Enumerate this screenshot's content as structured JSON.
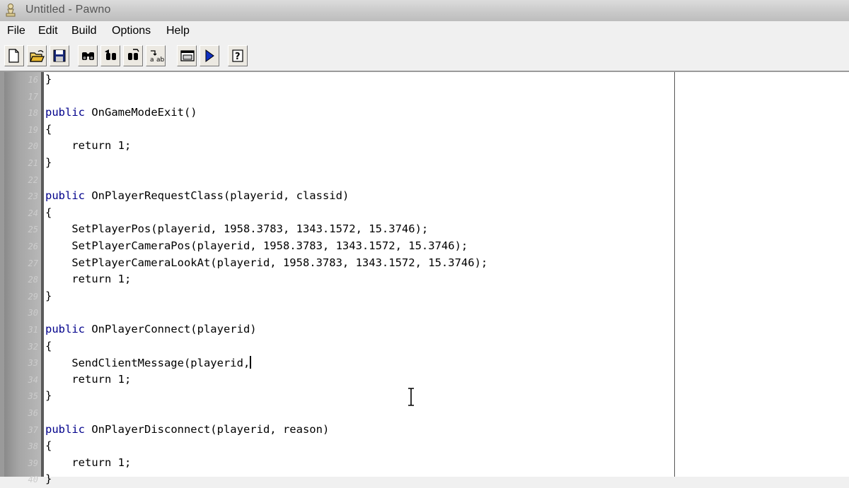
{
  "window": {
    "title": "Untitled - Pawno"
  },
  "menu": [
    "File",
    "Edit",
    "Build",
    "Options",
    "Help"
  ],
  "toolbar": {
    "buttons": [
      "new-file-icon",
      "open-folder-icon",
      "save-icon",
      "find-icon",
      "find-next-icon",
      "find-replace-icon",
      "replace-icon",
      "function-list-icon",
      "compile-run-icon",
      "help-icon"
    ]
  },
  "editor": {
    "lines": [
      {
        "num": "16",
        "keyword": "",
        "text": "}"
      },
      {
        "num": "17",
        "keyword": "",
        "text": ""
      },
      {
        "num": "18",
        "keyword": "public",
        "text": " OnGameModeExit()"
      },
      {
        "num": "19",
        "keyword": "",
        "text": "{"
      },
      {
        "num": "20",
        "keyword": "",
        "text": "    return 1;"
      },
      {
        "num": "21",
        "keyword": "",
        "text": "}"
      },
      {
        "num": "22",
        "keyword": "",
        "text": ""
      },
      {
        "num": "23",
        "keyword": "public",
        "text": " OnPlayerRequestClass(playerid, classid)"
      },
      {
        "num": "24",
        "keyword": "",
        "text": "{"
      },
      {
        "num": "25",
        "keyword": "",
        "text": "    SetPlayerPos(playerid, 1958.3783, 1343.1572, 15.3746);"
      },
      {
        "num": "26",
        "keyword": "",
        "text": "    SetPlayerCameraPos(playerid, 1958.3783, 1343.1572, 15.3746);"
      },
      {
        "num": "27",
        "keyword": "",
        "text": "    SetPlayerCameraLookAt(playerid, 1958.3783, 1343.1572, 15.3746);"
      },
      {
        "num": "28",
        "keyword": "",
        "text": "    return 1;"
      },
      {
        "num": "29",
        "keyword": "",
        "text": "}"
      },
      {
        "num": "30",
        "keyword": "",
        "text": ""
      },
      {
        "num": "31",
        "keyword": "public",
        "text": " OnPlayerConnect(playerid)"
      },
      {
        "num": "32",
        "keyword": "",
        "text": "{"
      },
      {
        "num": "33",
        "keyword": "",
        "text": "    SendClientMessage(playerid,"
      },
      {
        "num": "34",
        "keyword": "",
        "text": "    return 1;"
      },
      {
        "num": "35",
        "keyword": "",
        "text": "}"
      },
      {
        "num": "36",
        "keyword": "",
        "text": ""
      },
      {
        "num": "37",
        "keyword": "public",
        "text": " OnPlayerDisconnect(playerid, reason)"
      },
      {
        "num": "38",
        "keyword": "",
        "text": "{"
      },
      {
        "num": "39",
        "keyword": "",
        "text": "    return 1;"
      },
      {
        "num": "40",
        "keyword": "",
        "text": "}"
      }
    ],
    "cursor_line": "33"
  }
}
